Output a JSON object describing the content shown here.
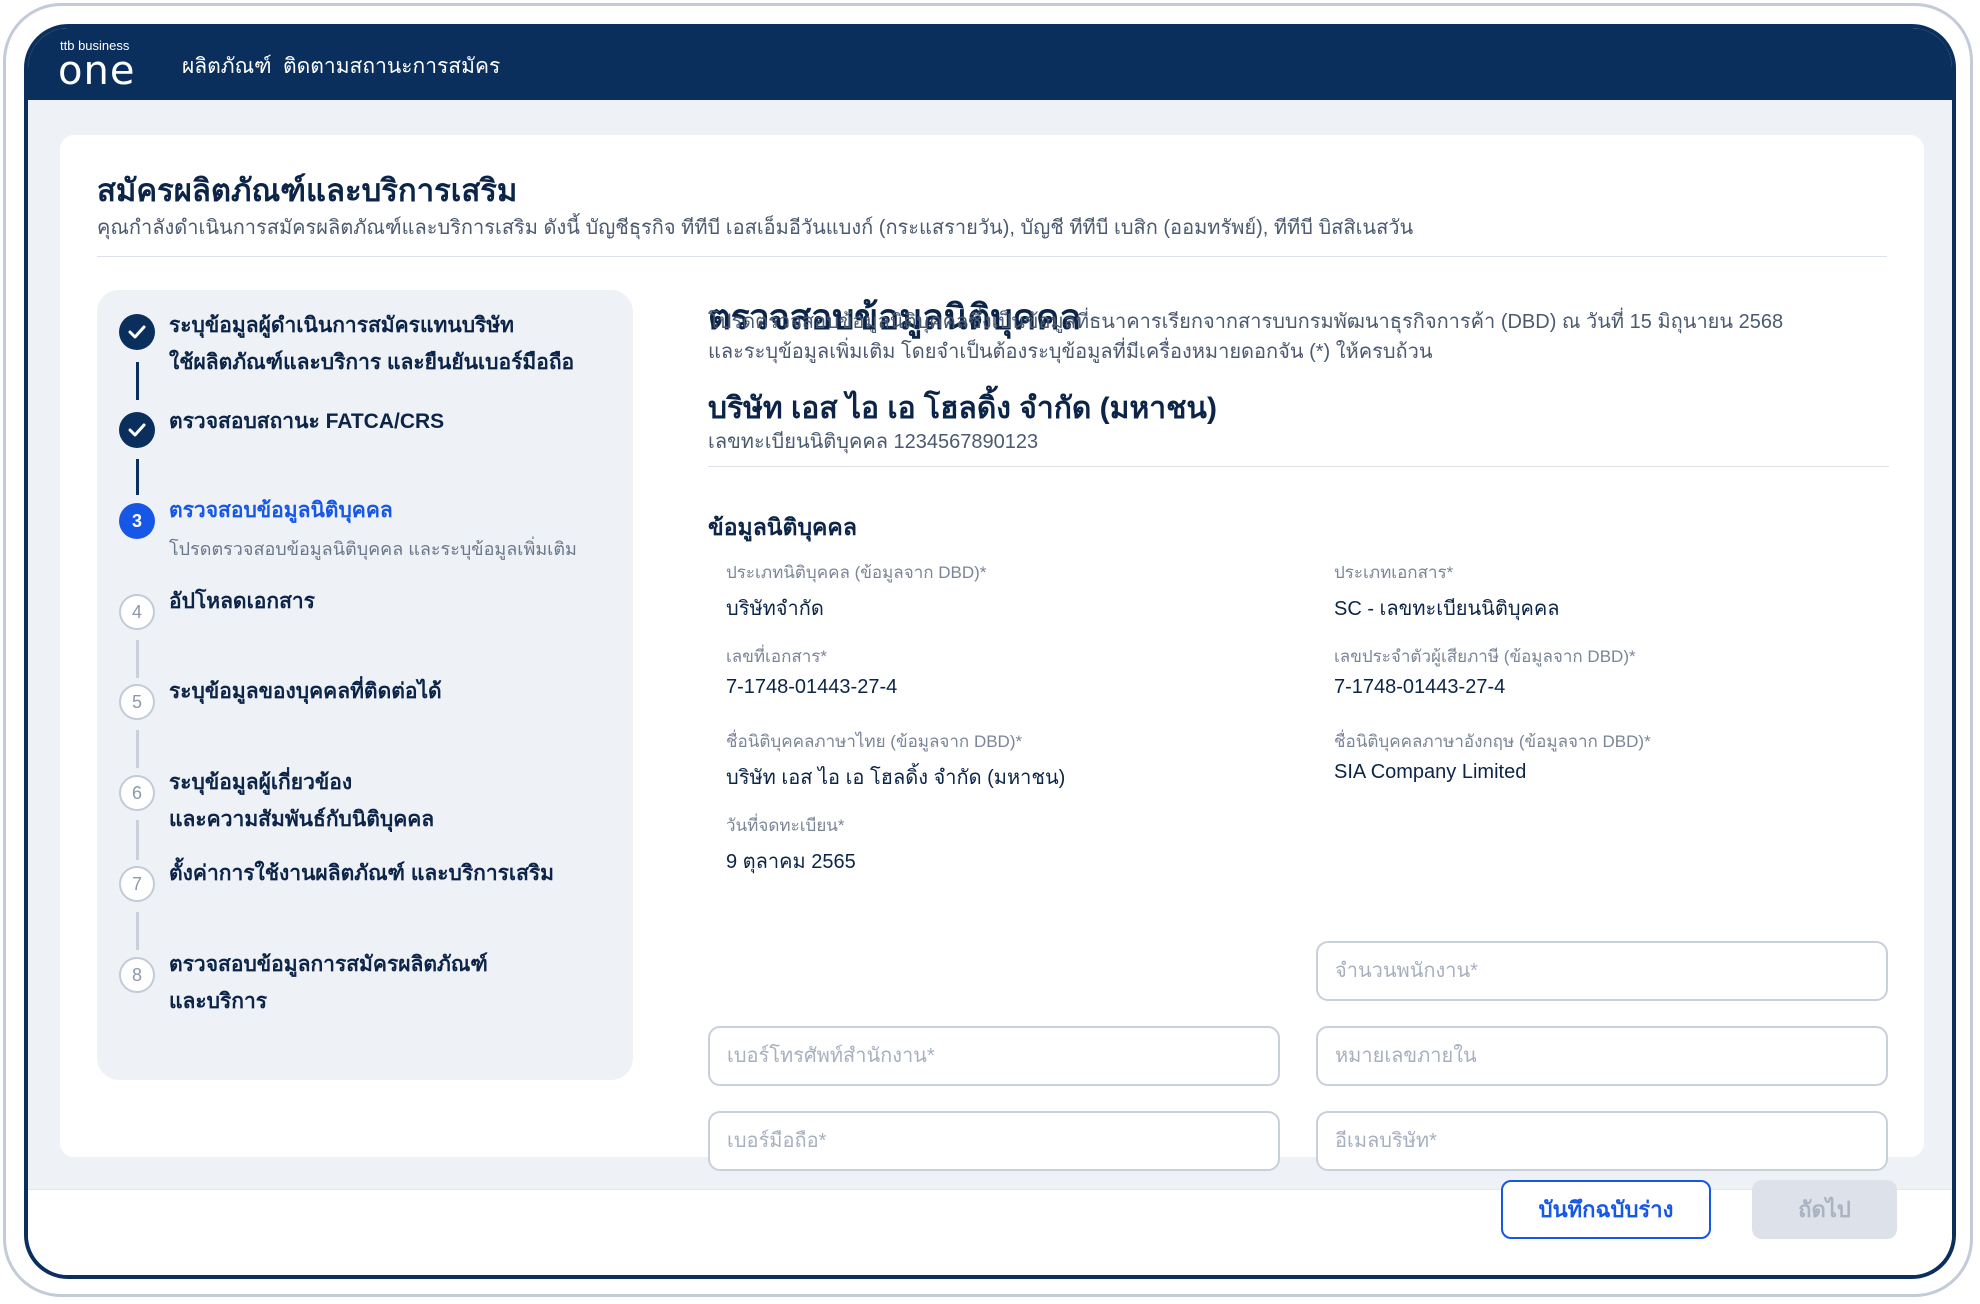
{
  "header": {
    "logo_small": "ttb business",
    "logo_big": "one",
    "nav": [
      "ผลิตภัณฑ์",
      "ติดตามสถานะการสมัคร"
    ]
  },
  "page": {
    "title": "สมัครผลิตภัณฑ์และบริการเสริม",
    "subtitle": "คุณกำลังดำเนินการสมัครผลิตภัณฑ์และบริการเสริม ดังนี้  บัญชีธุรกิจ ทีทีบี เอสเอ็มอีวันแบงก์ (กระแสรายวัน),  บัญชี ทีทีบี เบสิก (ออมทรัพย์),  ทีทีบี บิสสิเนสวัน"
  },
  "steps": [
    {
      "status": "done",
      "icon": "check-icon",
      "label_lines": [
        "ระบุข้อมูลผู้ดำเนินการสมัครแทนบริษัท",
        "ใช้ผลิตภัณฑ์และบริการ และยืนยันเบอร์มือถือ"
      ]
    },
    {
      "status": "done",
      "icon": "check-icon",
      "label_lines": [
        "ตรวจสอบสถานะ FATCA/CRS"
      ]
    },
    {
      "status": "current",
      "number": "3",
      "label_lines": [
        "ตรวจสอบข้อมูลนิติบุคคล"
      ],
      "desc": "โปรดตรวจสอบข้อมูลนิติบุคคล และระบุข้อมูลเพิ่มเติม"
    },
    {
      "status": "todo",
      "number": "4",
      "label_lines": [
        "อัปโหลดเอกสาร"
      ]
    },
    {
      "status": "todo",
      "number": "5",
      "label_lines": [
        "ระบุข้อมูลของบุคคลที่ติดต่อได้"
      ]
    },
    {
      "status": "todo",
      "number": "6",
      "label_lines": [
        "ระบุข้อมูลผู้เกี่ยวข้อง",
        "และความสัมพันธ์กับนิติบุคคล"
      ]
    },
    {
      "status": "todo",
      "number": "7",
      "label_lines": [
        "ตั้งค่าการใช้งานผลิตภัณฑ์ และบริการเสริม"
      ]
    },
    {
      "status": "todo",
      "number": "8",
      "label_lines": [
        "ตรวจสอบข้อมูลการสมัครผลิตภัณฑ์",
        "และบริการ"
      ]
    }
  ],
  "section": {
    "title": "ตรวจสอบข้อมูลนิติบุคคล",
    "desc_lines": [
      "โปรดตรวจสอบข้อมูลนิติบุคคลซึ่งเป็นข้อมูลที่ธนาคารเรียกจากสารบบกรมพัฒนาธุรกิจการค้า (DBD) ณ วันที่ 15 มิถุนายน 2568",
      "และระบุข้อมูลเพิ่มเติม โดยจำเป็นต้องระบุข้อมูลที่มีเครื่องหมายดอกจัน (*) ให้ครบถ้วน"
    ],
    "company_name": "บริษัท เอส ไอ เอ โฮลดิ้ง จำกัด (มหาชน)",
    "reg_no": "เลขทะเบียนนิติบุคคล 1234567890123",
    "group_title": "ข้อมูลนิติบุคคล"
  },
  "fields": {
    "entity_type": {
      "label": "ประเภทนิติบุคคล (ข้อมูลจาก DBD)*",
      "value": "บริษัทจำกัด"
    },
    "doc_type": {
      "label": "ประเภทเอกสาร*",
      "value": "SC - เลขทะเบียนนิติบุคคล"
    },
    "doc_no": {
      "label": "เลขที่เอกสาร*",
      "value": "7-1748-01443-27-4"
    },
    "tax_id": {
      "label": "เลขประจำตัวผู้เสียภาษี (ข้อมูลจาก DBD)*",
      "value": "7-1748-01443-27-4"
    },
    "name_th": {
      "label": "ชื่อนิติบุคคลภาษาไทย (ข้อมูลจาก DBD)*",
      "value": "บริษัท เอส ไอ เอ โฮลดิ้ง จำกัด (มหาชน)"
    },
    "name_en": {
      "label": "ชื่อนิติบุคคลภาษาอังกฤษ (ข้อมูลจาก DBD)*",
      "value": "SIA Company Limited"
    },
    "reg_date": {
      "label": "วันที่จดทะเบียน*",
      "value": "9 ตุลาคม 2565"
    }
  },
  "inputs": {
    "employees": {
      "placeholder": "จำนวนพนักงาน*",
      "value": ""
    },
    "office_phone": {
      "placeholder": "เบอร์โทรศัพท์สำนักงาน*",
      "value": ""
    },
    "extension": {
      "placeholder": "หมายเลขภายใน",
      "value": ""
    },
    "mobile": {
      "placeholder": "เบอร์มือถือ*",
      "value": ""
    },
    "email": {
      "placeholder": "อีเมลบริษัท*",
      "value": ""
    }
  },
  "footer": {
    "save_draft": "บันทึกฉบับร่าง",
    "next": "ถัดไป"
  },
  "colors": {
    "navy": "#0b2f5c",
    "accent": "#1657e6",
    "disabled": "#dde2ea"
  }
}
